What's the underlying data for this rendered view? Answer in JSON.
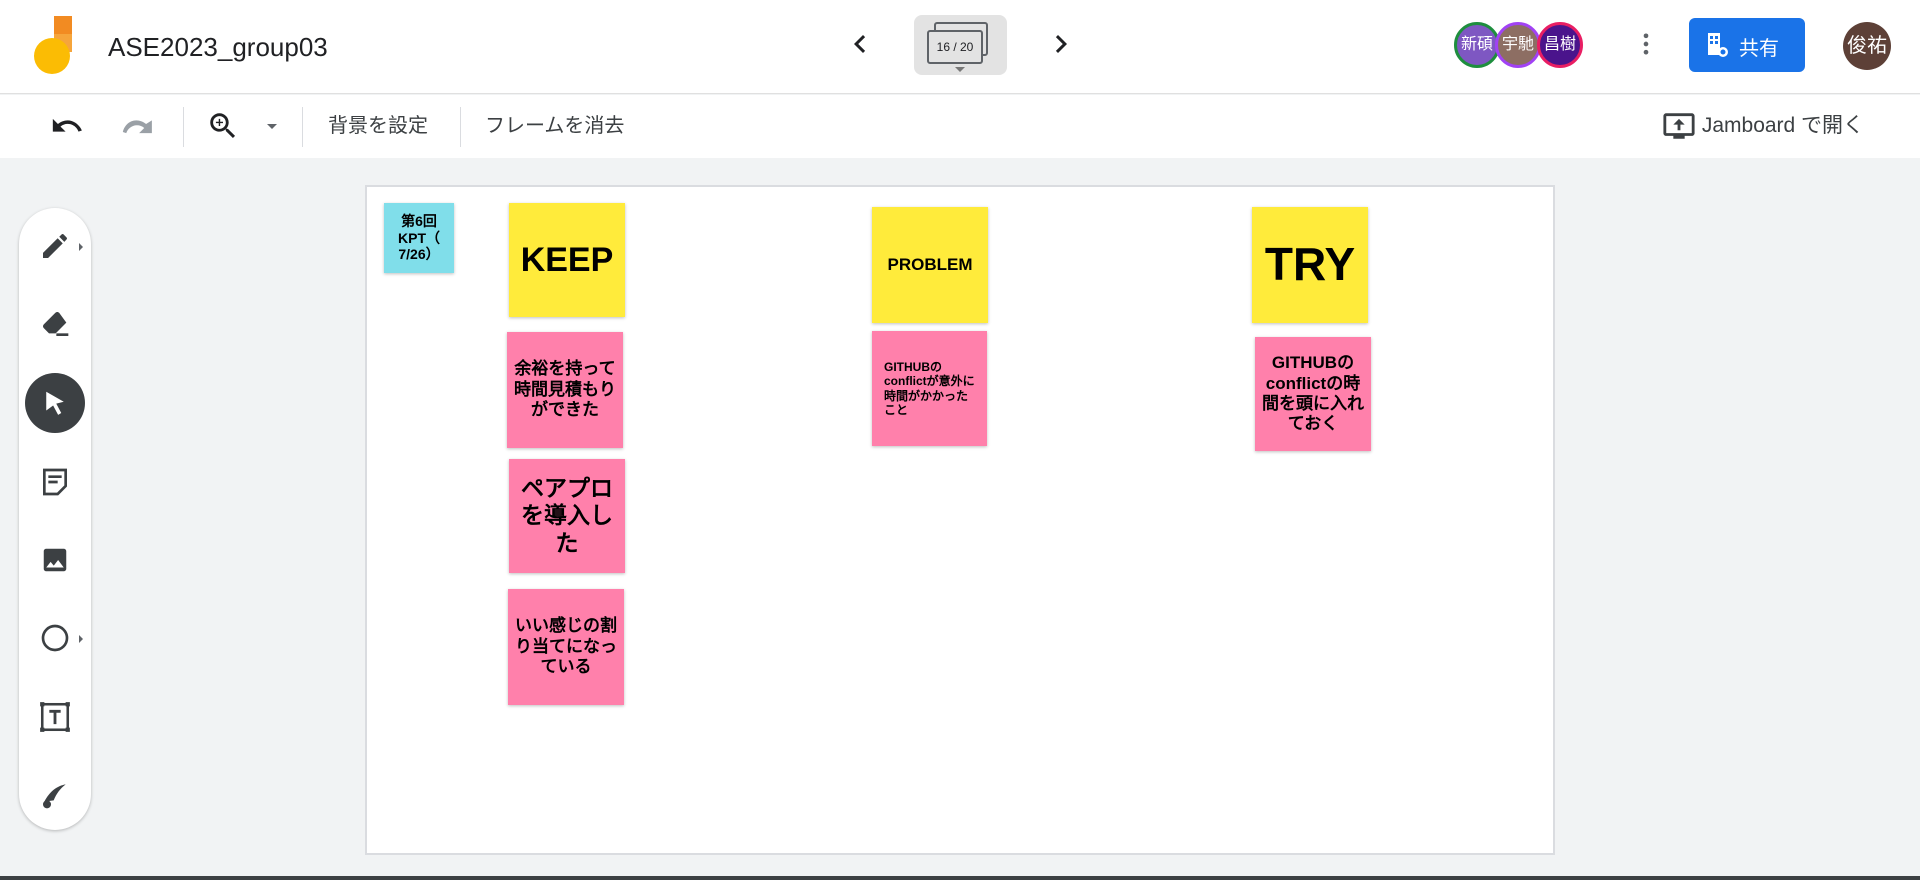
{
  "app": {
    "title": "ASE2023_group03",
    "frame_counter": "16 / 20",
    "collaborators": [
      {
        "label": "新碩",
        "bg": "#7e57c2",
        "ring": "#1e8e3e"
      },
      {
        "label": "宇馳",
        "bg": "#8d6e63",
        "ring": "#a142f4"
      },
      {
        "label": "昌樹",
        "bg": "#4a148c",
        "ring": "#e91e63"
      }
    ],
    "share_label": "共有",
    "user_avatar": "俊祐"
  },
  "toolbar": {
    "background_label": "背景を設定",
    "clear_frame_label": "フレームを消去",
    "open_in_jamboard_label": "Jamboard で開く"
  },
  "rail_tools": [
    {
      "name": "pen-tool",
      "icon": "pen-icon",
      "has_submenu": true,
      "active": false
    },
    {
      "name": "eraser-tool",
      "icon": "eraser-icon",
      "has_submenu": false,
      "active": false
    },
    {
      "name": "select-tool",
      "icon": "cursor-icon",
      "has_submenu": false,
      "active": true
    },
    {
      "name": "sticky-note-tool",
      "icon": "sticky-note-icon",
      "has_submenu": false,
      "active": false
    },
    {
      "name": "image-tool",
      "icon": "image-icon",
      "has_submenu": false,
      "active": false
    },
    {
      "name": "shape-tool",
      "icon": "circle-icon",
      "has_submenu": true,
      "active": false
    },
    {
      "name": "text-box-tool",
      "icon": "text-box-icon",
      "has_submenu": false,
      "active": false
    },
    {
      "name": "laser-tool",
      "icon": "laser-icon",
      "has_submenu": false,
      "active": false
    }
  ],
  "notes": {
    "title": "第6回 KPT（ 7/26）",
    "keep_header": "KEEP",
    "keep_1": "余裕を持って時間見積もりができた",
    "keep_2": "ペアプロを導入した",
    "keep_3": "いい感じの割り当てになっている",
    "problem_header": "PROBLEM",
    "problem_1": "GITHUBのconflictが意外に時間がかかったこと",
    "try_header": "TRY",
    "try_1": "GITHUBのconflictの時間を頭に入れておく"
  },
  "colors": {
    "accent": "#1a73e8",
    "note_yellow": "#ffeb3b",
    "note_pink": "#ff80ab",
    "note_cyan": "#80deea"
  }
}
